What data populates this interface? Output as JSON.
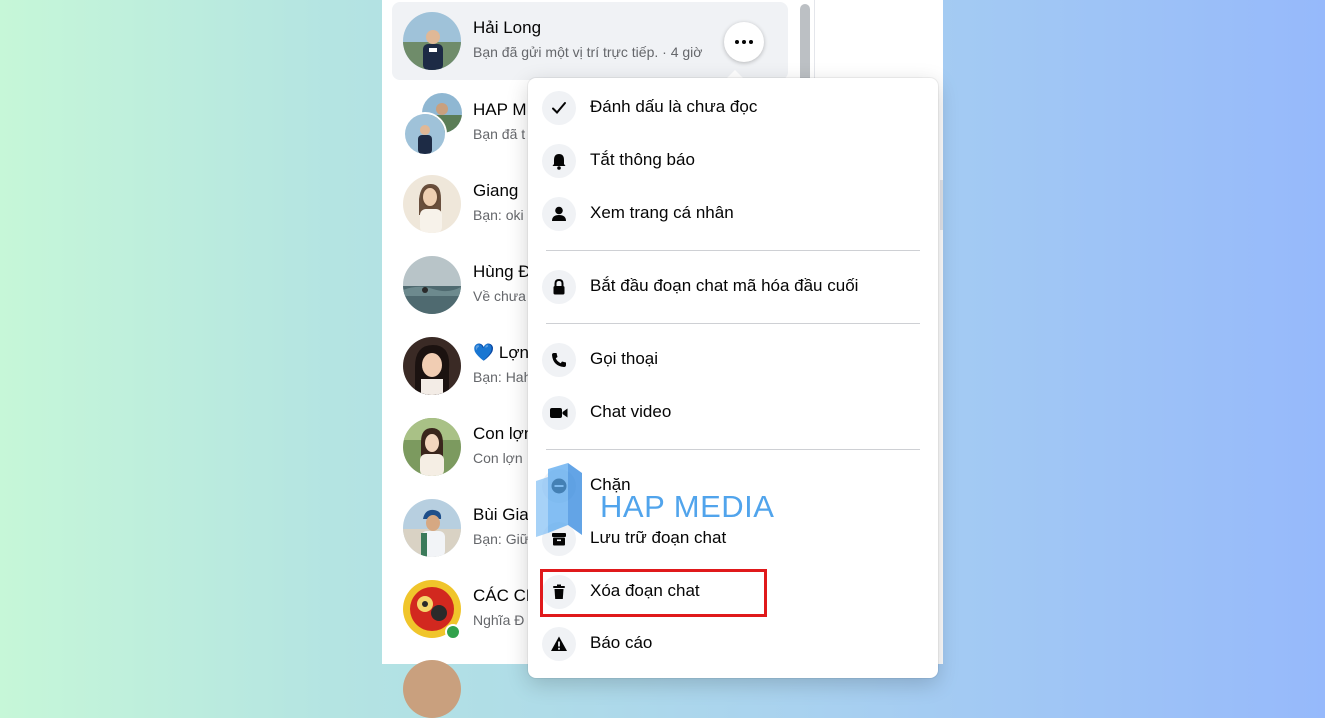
{
  "chats": [
    {
      "name": "Hải Long",
      "preview": "Bạn đã gửi một vị trí trực tiếp. · 4 giờ",
      "active": true
    },
    {
      "name": "HAP M",
      "preview": "Bạn đã t"
    },
    {
      "name": "Giang",
      "preview": "Bạn: oki"
    },
    {
      "name": "Hùng Đ",
      "preview": "Về chưa"
    },
    {
      "name": "💙 Lợn",
      "preview": "Bạn: Hah"
    },
    {
      "name": "Con lợn",
      "preview": "Con lợn"
    },
    {
      "name": "Bùi Gia",
      "preview": "Bạn: Giữ"
    },
    {
      "name": "CÁC CH",
      "preview": "Nghĩa Đ",
      "online": true
    }
  ],
  "menu": {
    "items": [
      {
        "label": "Đánh dấu là chưa đọc",
        "icon": "check-icon"
      },
      {
        "label": "Tắt thông báo",
        "icon": "bell-icon"
      },
      {
        "label": "Xem trang cá nhân",
        "icon": "person-icon"
      },
      {
        "label": "Bắt đầu đoạn chat mã hóa đầu cuối",
        "icon": "lock-icon"
      },
      {
        "label": "Gọi thoại",
        "icon": "phone-icon"
      },
      {
        "label": "Chat video",
        "icon": "video-icon"
      },
      {
        "label": "Chặn",
        "icon": "block-icon"
      },
      {
        "label": "Lưu trữ đoạn chat",
        "icon": "archive-icon"
      },
      {
        "label": "Xóa đoạn chat",
        "icon": "trash-icon"
      },
      {
        "label": "Báo cáo",
        "icon": "warning-icon"
      }
    ]
  },
  "watermark": {
    "text": "HAP MEDIA"
  },
  "colors": {
    "highlight": "#e0191b",
    "online": "#31a24c",
    "watermark": "#3f9bea"
  }
}
